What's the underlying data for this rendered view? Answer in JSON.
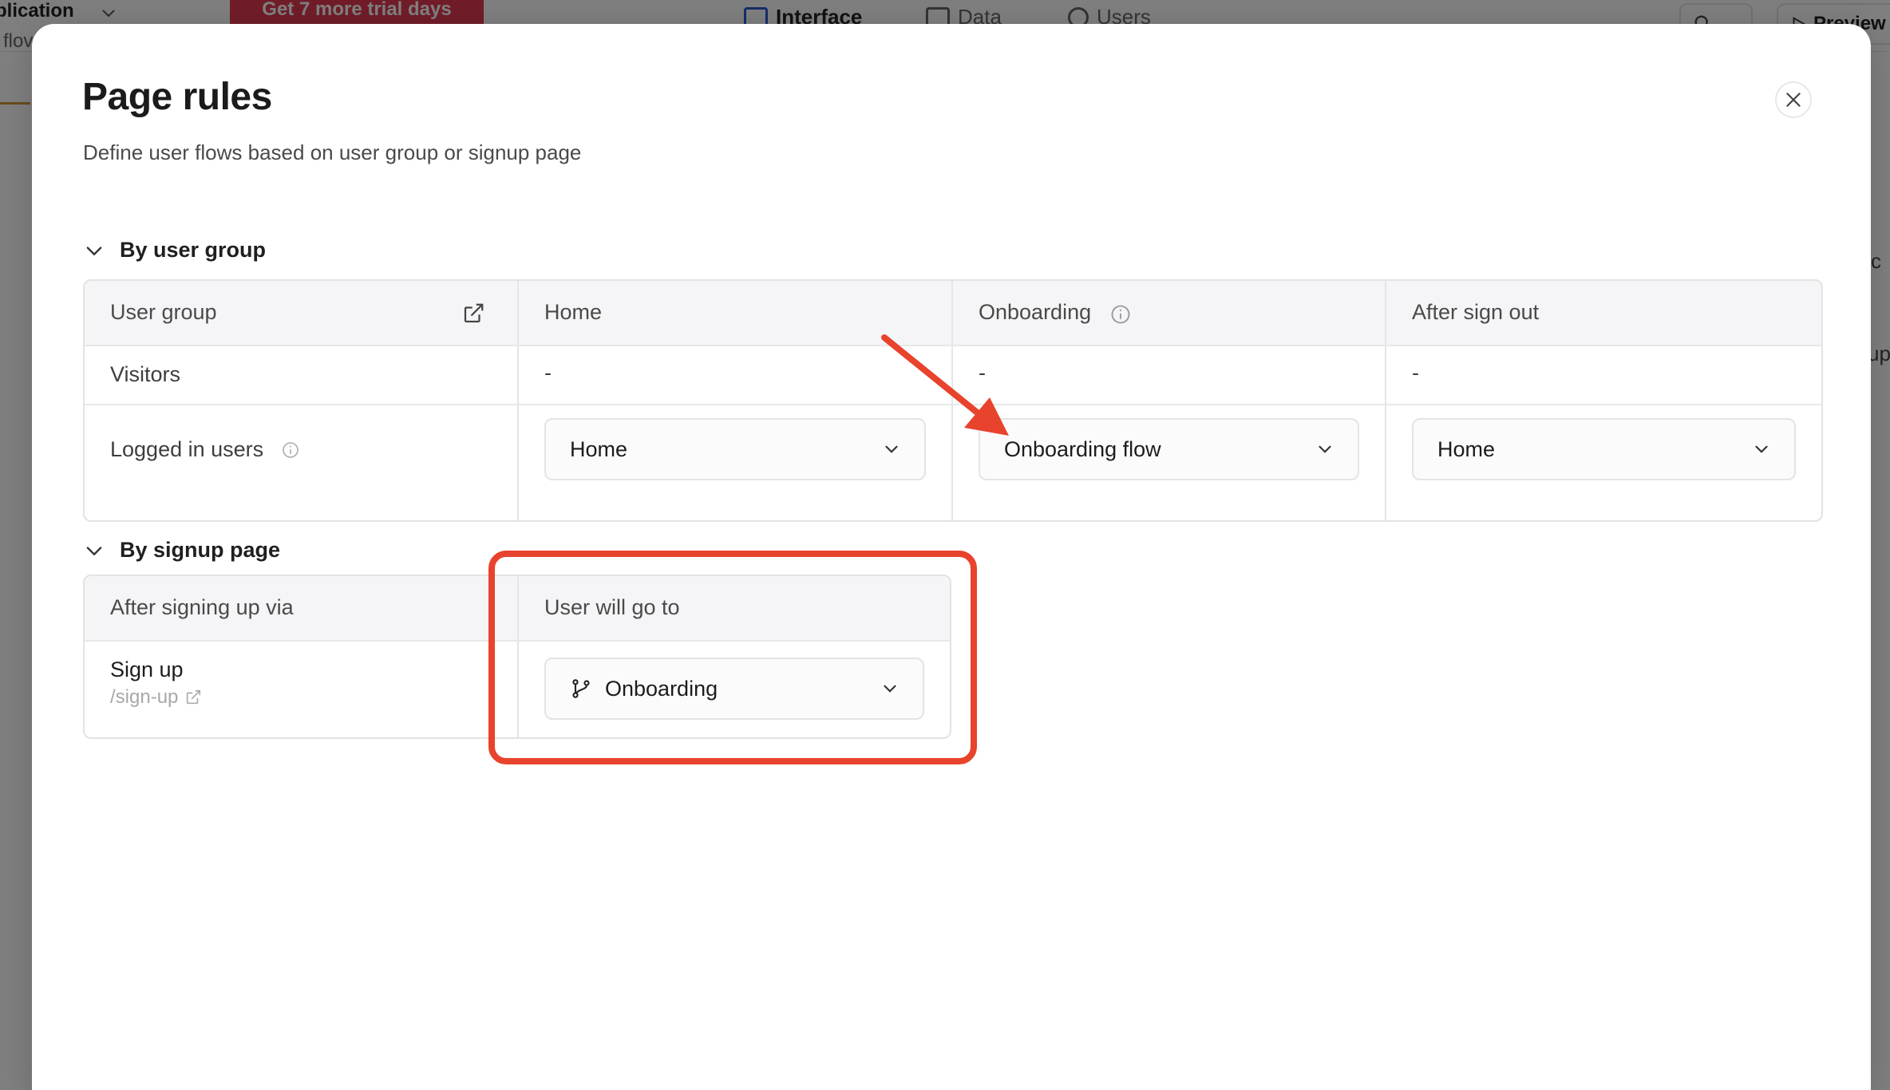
{
  "background": {
    "app_name": "plication",
    "app_sub": "flov",
    "trial_button": "Get 7 more trial days",
    "nav": [
      {
        "label": "Interface",
        "icon": "layout-icon"
      },
      {
        "label": "Data",
        "icon": "table-icon"
      },
      {
        "label": "Users",
        "icon": "users-icon"
      }
    ],
    "preview_label": "Preview",
    "right_text_1": "c",
    "right_text_2": "up"
  },
  "modal": {
    "title": "Page rules",
    "subtitle": "Define user flows based on user group or signup page",
    "close_icon": "close-icon"
  },
  "by_user_group": {
    "section_label": "By user group",
    "headers": {
      "user_group": "User group",
      "home": "Home",
      "onboarding": "Onboarding",
      "after_sign_out": "After sign out"
    },
    "rows": [
      {
        "group": "Visitors",
        "home": "-",
        "onboarding": "-",
        "after_sign_out": "-"
      },
      {
        "group": "Logged in users",
        "home": "Home",
        "onboarding": "Onboarding flow",
        "after_sign_out": "Home"
      }
    ]
  },
  "by_signup_page": {
    "section_label": "By signup page",
    "headers": {
      "after_signing_up_via": "After signing up via",
      "user_will_go_to": "User will go to"
    },
    "rows": [
      {
        "page_name": "Sign up",
        "page_path": "/sign-up",
        "destination": "Onboarding"
      }
    ]
  },
  "annotation_color": "#e8432c",
  "accent_colors": {
    "trial_button": "#e23a52",
    "nav_active": "#2c5ad8"
  }
}
